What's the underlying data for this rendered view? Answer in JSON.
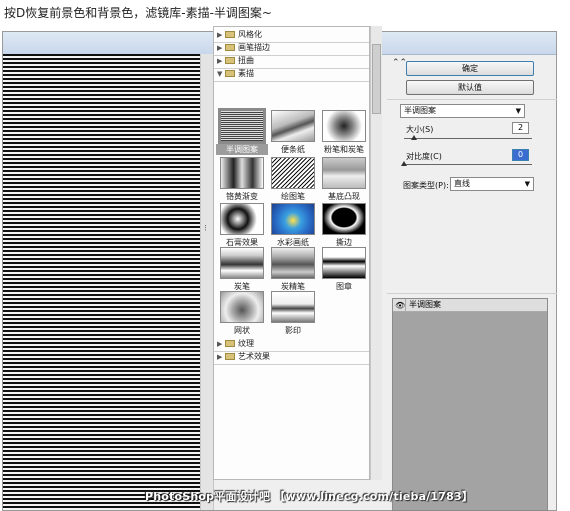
{
  "caption": "按D恢复前景色和背景色，滤镜库-素描-半调图案~",
  "gallery": {
    "folders_top": [
      {
        "label": "风格化"
      },
      {
        "label": "画笔描边"
      },
      {
        "label": "扭曲"
      },
      {
        "label": "素描",
        "open": true
      }
    ],
    "filters": [
      {
        "label": "半调图案",
        "selected": true
      },
      {
        "label": "便条纸"
      },
      {
        "label": "粉笔和炭笔"
      },
      {
        "label": "铬黄渐变"
      },
      {
        "label": "绘图笔"
      },
      {
        "label": "基底凸现"
      },
      {
        "label": "石膏效果"
      },
      {
        "label": "水彩画纸"
      },
      {
        "label": "撕边"
      },
      {
        "label": "炭笔"
      },
      {
        "label": "炭精笔"
      },
      {
        "label": "图章"
      },
      {
        "label": "网状"
      },
      {
        "label": "影印"
      }
    ],
    "folders_bottom": [
      {
        "label": "纹理"
      },
      {
        "label": "艺术效果"
      }
    ]
  },
  "controls": {
    "collapse_icon": "double-chevron-up",
    "ok_label": "确定",
    "default_label": "默认值",
    "filter_select": "半调图案",
    "size_label": "大小(S)",
    "size_value": "2",
    "size_fraction": 0.08,
    "contrast_label": "对比度(C)",
    "contrast_value": "0",
    "contrast_fraction": 0.0,
    "pattern_type_label": "图案类型(P):",
    "pattern_type_value": "直线"
  },
  "layers": {
    "items": [
      {
        "name": "半调图案",
        "visible": true
      }
    ]
  },
  "watermark": "PhotoShop平面设计吧 【www.linecg.com/tieba/1783】"
}
